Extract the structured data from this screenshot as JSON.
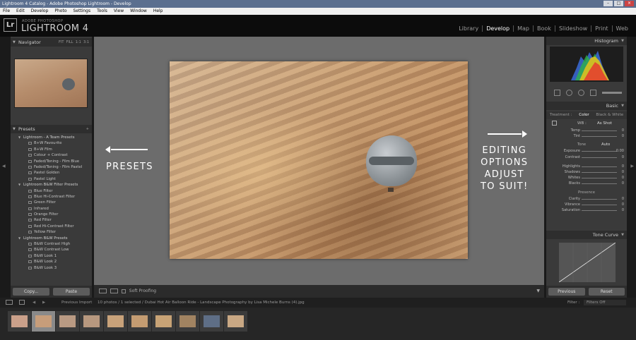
{
  "window": {
    "title": "Lightroom 4 Catalog - Adobe Photoshop Lightroom - Develop"
  },
  "menu": [
    "File",
    "Edit",
    "Develop",
    "Photo",
    "Settings",
    "Tools",
    "View",
    "Window",
    "Help"
  ],
  "identity": {
    "logo": "Lr",
    "small": "ADOBE PHOTOSHOP",
    "large": "LIGHTROOM 4"
  },
  "modules": [
    "Library",
    "Develop",
    "Map",
    "Book",
    "Slideshow",
    "Print",
    "Web"
  ],
  "navigator": {
    "title": "Navigator",
    "zoom": [
      "FIT",
      "FILL",
      "1:1",
      "3:1"
    ]
  },
  "presets_panel": {
    "title": "Presets",
    "items": [
      {
        "type": "folder",
        "label": "Lightroom - A Team Presets"
      },
      {
        "type": "preset",
        "label": "B+W Favourite"
      },
      {
        "type": "preset",
        "label": "B+W Film"
      },
      {
        "type": "preset",
        "label": "Colour + Contrast"
      },
      {
        "type": "preset",
        "label": "Faded/Toning - Film Blue"
      },
      {
        "type": "preset",
        "label": "Faded/Toning - Film Pastel"
      },
      {
        "type": "preset",
        "label": "Pastel Golden"
      },
      {
        "type": "preset",
        "label": "Pastel Light"
      },
      {
        "type": "folder",
        "label": "Lightroom B&W Filter Presets"
      },
      {
        "type": "preset",
        "label": "Blue Filter"
      },
      {
        "type": "preset",
        "label": "Blue Hi-Contrast Filter"
      },
      {
        "type": "preset",
        "label": "Green Filter"
      },
      {
        "type": "preset",
        "label": "Infrared"
      },
      {
        "type": "preset",
        "label": "Orange Filter"
      },
      {
        "type": "preset",
        "label": "Red Filter"
      },
      {
        "type": "preset",
        "label": "Red Hi-Contrast Filter"
      },
      {
        "type": "preset",
        "label": "Yellow Filter"
      },
      {
        "type": "folder",
        "label": "Lightroom B&W Presets"
      },
      {
        "type": "preset",
        "label": "B&W Contrast High"
      },
      {
        "type": "preset",
        "label": "B&W Contrast Low"
      },
      {
        "type": "preset",
        "label": "B&W Look 1"
      },
      {
        "type": "preset",
        "label": "B&W Look 2"
      },
      {
        "type": "preset",
        "label": "B&W Look 3"
      }
    ],
    "copy": "Copy...",
    "paste": "Paste"
  },
  "annotations": {
    "left": "PRESETS",
    "right": [
      "EDITING",
      "OPTIONS",
      "ADJUST",
      "TO SUIT!"
    ]
  },
  "toolbar": {
    "soft_proofing": "Soft Proofing"
  },
  "histogram": {
    "title": "Histogram"
  },
  "basic": {
    "title": "Basic",
    "tabs": [
      "Treatment :",
      "Color",
      "Black & White"
    ],
    "wb_label": "WB :",
    "wb_value": "As Shot",
    "tone_label": "Tone",
    "auto": "Auto",
    "presence_label": "Presence",
    "sliders_wb": [
      {
        "label": "Temp",
        "value": "0"
      },
      {
        "label": "Tint",
        "value": "0"
      }
    ],
    "sliders_tone": [
      {
        "label": "Exposure",
        "value": "0.00"
      },
      {
        "label": "Contrast",
        "value": "0"
      }
    ],
    "sliders_tone2": [
      {
        "label": "Highlights",
        "value": "0"
      },
      {
        "label": "Shadows",
        "value": "0"
      },
      {
        "label": "Whites",
        "value": "0"
      },
      {
        "label": "Blacks",
        "value": "0"
      }
    ],
    "sliders_presence": [
      {
        "label": "Clarity",
        "value": "0"
      },
      {
        "label": "Vibrance",
        "value": "0"
      },
      {
        "label": "Saturation",
        "value": "0"
      }
    ]
  },
  "tone_curve": {
    "title": "Tone Curve"
  },
  "right_buttons": {
    "previous": "Previous",
    "reset": "Reset"
  },
  "filmstrip": {
    "source": "Previous Import",
    "info": "10 photos / 1 selected / Dubai Hot Air Balloon Ride - Landscape Photography by Lisa Michele Burns (4).jpg",
    "filter_label": "Filter :",
    "filter_value": "Filters Off"
  },
  "colors": {
    "accent_white": "#ffffff",
    "panel": "#3a3a3a",
    "center_bg": "#6c6c6c"
  }
}
